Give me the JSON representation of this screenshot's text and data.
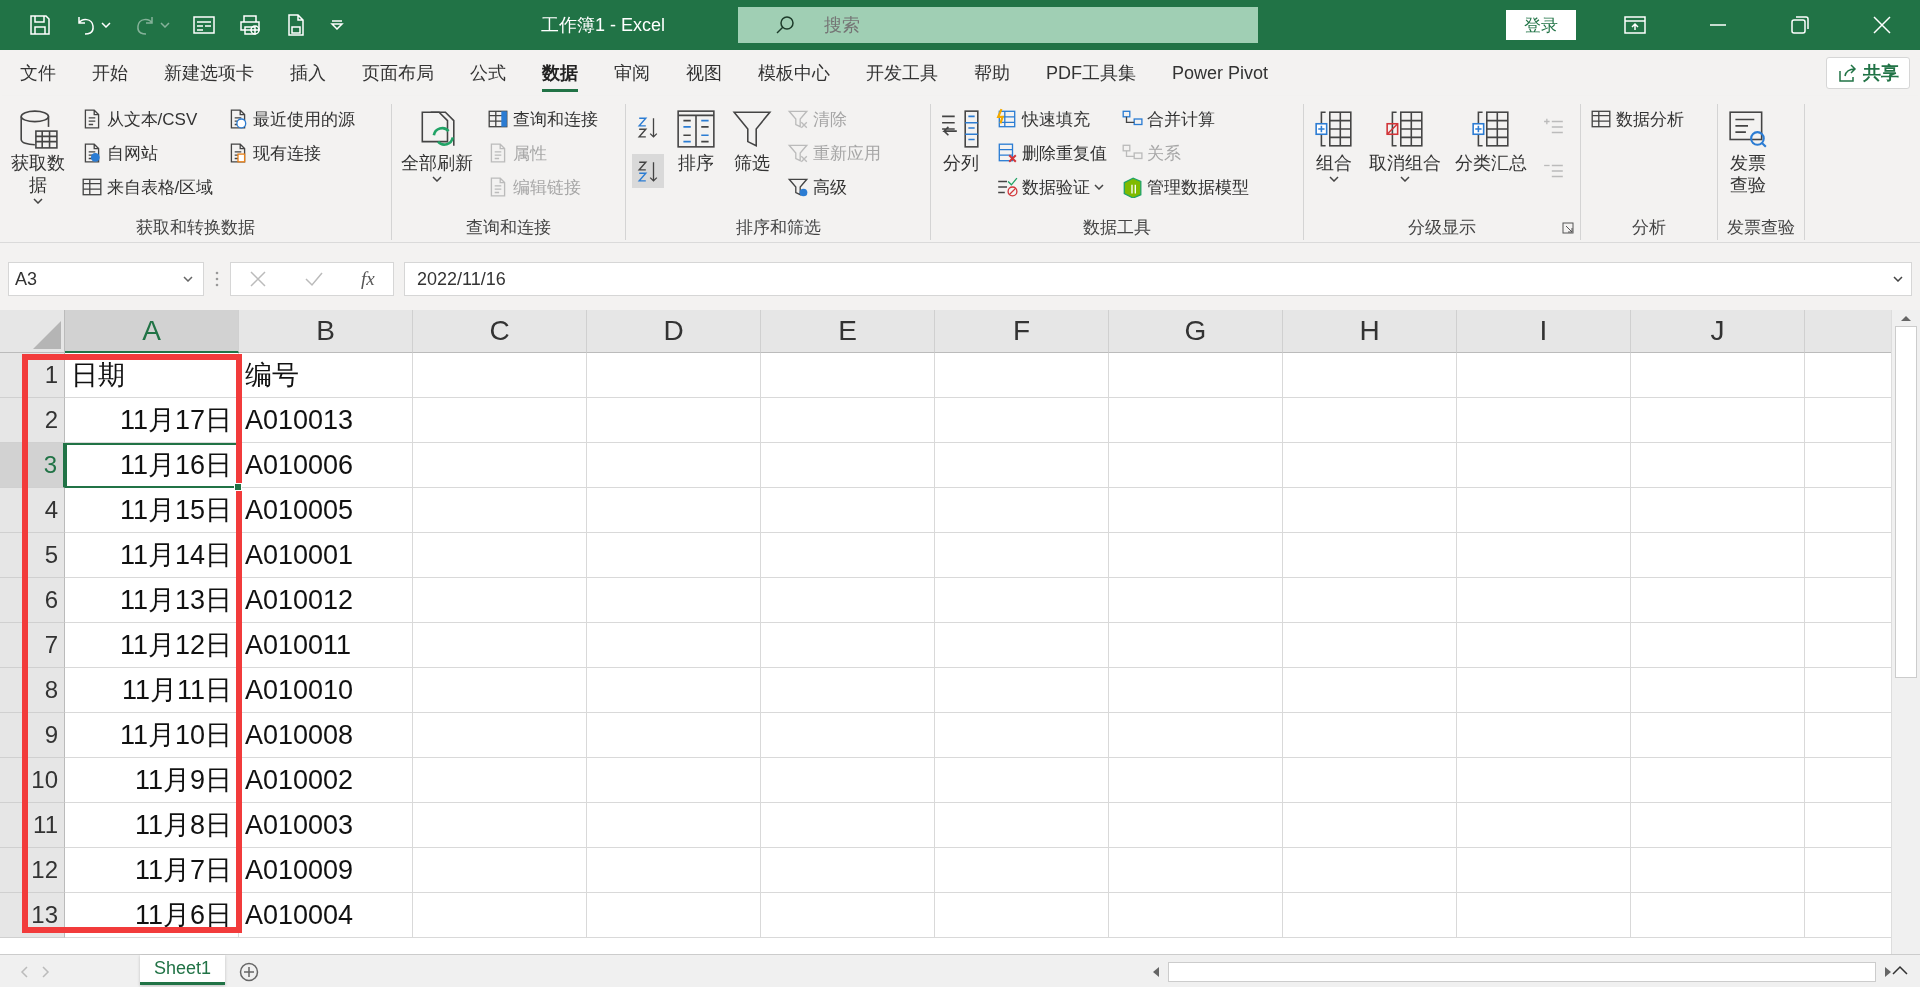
{
  "title_bar": {
    "title": "工作簿1  -  Excel",
    "search": {
      "placeholder": "搜索"
    },
    "login_button": "登录"
  },
  "menu_tabs": [
    {
      "label": "文件",
      "selected": false
    },
    {
      "label": "开始",
      "selected": false
    },
    {
      "label": "新建选项卡",
      "selected": false
    },
    {
      "label": "插入",
      "selected": false
    },
    {
      "label": "页面布局",
      "selected": false
    },
    {
      "label": "公式",
      "selected": false
    },
    {
      "label": "数据",
      "selected": true
    },
    {
      "label": "审阅",
      "selected": false
    },
    {
      "label": "视图",
      "selected": false
    },
    {
      "label": "模板中心",
      "selected": false
    },
    {
      "label": "开发工具",
      "selected": false
    },
    {
      "label": "帮助",
      "selected": false
    },
    {
      "label": "PDF工具集",
      "selected": false
    },
    {
      "label": "Power Pivot",
      "selected": false
    }
  ],
  "share_button": "共享",
  "ribbon_groups": [
    {
      "label": "获取和转换数据",
      "items": [
        {
          "kind": "large",
          "label": "获取数据",
          "dropdown": true,
          "disabled": false
        },
        {
          "kind": "small",
          "label": "从文本/CSV",
          "dropdown": false,
          "disabled": false
        },
        {
          "kind": "small",
          "label": "自网站",
          "dropdown": false,
          "disabled": false
        },
        {
          "kind": "small",
          "label": "来自表格/区域",
          "dropdown": false,
          "disabled": false
        },
        {
          "kind": "small",
          "label": "最近使用的源",
          "dropdown": false,
          "disabled": false
        },
        {
          "kind": "small",
          "label": "现有连接",
          "dropdown": false,
          "disabled": false
        }
      ]
    },
    {
      "label": "查询和连接",
      "items": [
        {
          "kind": "large",
          "label": "全部刷新",
          "dropdown": true,
          "disabled": false
        },
        {
          "kind": "small",
          "label": "查询和连接",
          "dropdown": false,
          "disabled": false
        },
        {
          "kind": "small",
          "label": "属性",
          "dropdown": false,
          "disabled": true
        },
        {
          "kind": "small",
          "label": "编辑链接",
          "dropdown": false,
          "disabled": true
        }
      ]
    },
    {
      "label": "排序和筛选",
      "items": [
        {
          "kind": "icon",
          "highlighted": false,
          "disabled": false
        },
        {
          "kind": "icon",
          "highlighted": true,
          "disabled": false
        },
        {
          "kind": "large",
          "label": "排序",
          "dropdown": false,
          "disabled": false
        },
        {
          "kind": "large",
          "label": "筛选",
          "dropdown": false,
          "disabled": false
        },
        {
          "kind": "small",
          "label": "清除",
          "dropdown": false,
          "disabled": true
        },
        {
          "kind": "small",
          "label": "重新应用",
          "dropdown": false,
          "disabled": true
        },
        {
          "kind": "small",
          "label": "高级",
          "dropdown": false,
          "disabled": false
        }
      ]
    },
    {
      "label": "数据工具",
      "items": [
        {
          "kind": "large",
          "label": "分列",
          "dropdown": false,
          "disabled": false
        },
        {
          "kind": "small",
          "label": "快速填充",
          "dropdown": false,
          "disabled": false
        },
        {
          "kind": "small",
          "label": "删除重复值",
          "dropdown": false,
          "disabled": false
        },
        {
          "kind": "small",
          "label": "数据验证",
          "dropdown": true,
          "disabled": false
        },
        {
          "kind": "small",
          "label": "合并计算",
          "dropdown": false,
          "disabled": false
        },
        {
          "kind": "small",
          "label": "关系",
          "dropdown": false,
          "disabled": true
        },
        {
          "kind": "small",
          "label": "管理数据模型",
          "dropdown": false,
          "disabled": false
        }
      ]
    },
    {
      "label": "分级显示",
      "launcher": true,
      "items": [
        {
          "kind": "large",
          "label": "组合",
          "dropdown": true,
          "disabled": false
        },
        {
          "kind": "large",
          "label": "取消组合",
          "dropdown": true,
          "disabled": false
        },
        {
          "kind": "large",
          "label": "分类汇总",
          "dropdown": false,
          "disabled": false
        },
        {
          "kind": "icon",
          "highlighted": false,
          "disabled": true
        },
        {
          "kind": "icon",
          "highlighted": false,
          "disabled": true
        }
      ]
    },
    {
      "label": "分析",
      "items": [
        {
          "kind": "small",
          "label": "数据分析",
          "dropdown": false,
          "disabled": false
        }
      ]
    },
    {
      "label": "发票查验",
      "items": [
        {
          "kind": "large",
          "label": "发票查验",
          "dropdown": false,
          "disabled": false
        }
      ]
    }
  ],
  "formula_bar": {
    "name_box": "A3",
    "function_label": "fx",
    "formula": "2022/11/16"
  },
  "sheet": {
    "columns": [
      "A",
      "B",
      "C",
      "D",
      "E",
      "F",
      "G",
      "H",
      "I",
      "J"
    ],
    "rows": [
      {
        "number": "1",
        "cells": [
          {
            "text": "日期",
            "kind": "text",
            "selected": false
          },
          {
            "text": "编号",
            "kind": "text",
            "selected": false
          }
        ]
      },
      {
        "number": "2",
        "cells": [
          {
            "text": "11月17日",
            "kind": "date",
            "selected": false
          },
          {
            "text": "A010013",
            "kind": "text",
            "selected": false
          }
        ]
      },
      {
        "number": "3",
        "cells": [
          {
            "text": "11月16日",
            "kind": "date",
            "selected": true
          },
          {
            "text": "A010006",
            "kind": "text",
            "selected": false
          }
        ]
      },
      {
        "number": "4",
        "cells": [
          {
            "text": "11月15日",
            "kind": "date",
            "selected": false
          },
          {
            "text": "A010005",
            "kind": "text",
            "selected": false
          }
        ]
      },
      {
        "number": "5",
        "cells": [
          {
            "text": "11月14日",
            "kind": "date",
            "selected": false
          },
          {
            "text": "A010001",
            "kind": "text",
            "selected": false
          }
        ]
      },
      {
        "number": "6",
        "cells": [
          {
            "text": "11月13日",
            "kind": "date",
            "selected": false
          },
          {
            "text": "A010012",
            "kind": "text",
            "selected": false
          }
        ]
      },
      {
        "number": "7",
        "cells": [
          {
            "text": "11月12日",
            "kind": "date",
            "selected": false
          },
          {
            "text": "A010011",
            "kind": "text",
            "selected": false
          }
        ]
      },
      {
        "number": "8",
        "cells": [
          {
            "text": "11月11日",
            "kind": "date",
            "selected": false
          },
          {
            "text": "A010010",
            "kind": "text",
            "selected": false
          }
        ]
      },
      {
        "number": "9",
        "cells": [
          {
            "text": "11月10日",
            "kind": "date",
            "selected": false
          },
          {
            "text": "A010008",
            "kind": "text",
            "selected": false
          }
        ]
      },
      {
        "number": "10",
        "cells": [
          {
            "text": "11月9日",
            "kind": "date",
            "selected": false
          },
          {
            "text": "A010002",
            "kind": "text",
            "selected": false
          }
        ]
      },
      {
        "number": "11",
        "cells": [
          {
            "text": "11月8日",
            "kind": "date",
            "selected": false
          },
          {
            "text": "A010003",
            "kind": "text",
            "selected": false
          }
        ]
      },
      {
        "number": "12",
        "cells": [
          {
            "text": "11月7日",
            "kind": "date",
            "selected": false
          },
          {
            "text": "A010009",
            "kind": "text",
            "selected": false
          }
        ]
      },
      {
        "number": "13",
        "cells": [
          {
            "text": "11月6日",
            "kind": "date",
            "selected": false
          },
          {
            "text": "A010004",
            "kind": "text",
            "selected": false
          }
        ]
      }
    ],
    "annotation": {
      "kind": "rectangle"
    }
  },
  "sheet_tabs": [
    {
      "label": "Sheet1",
      "selected": true
    }
  ]
}
